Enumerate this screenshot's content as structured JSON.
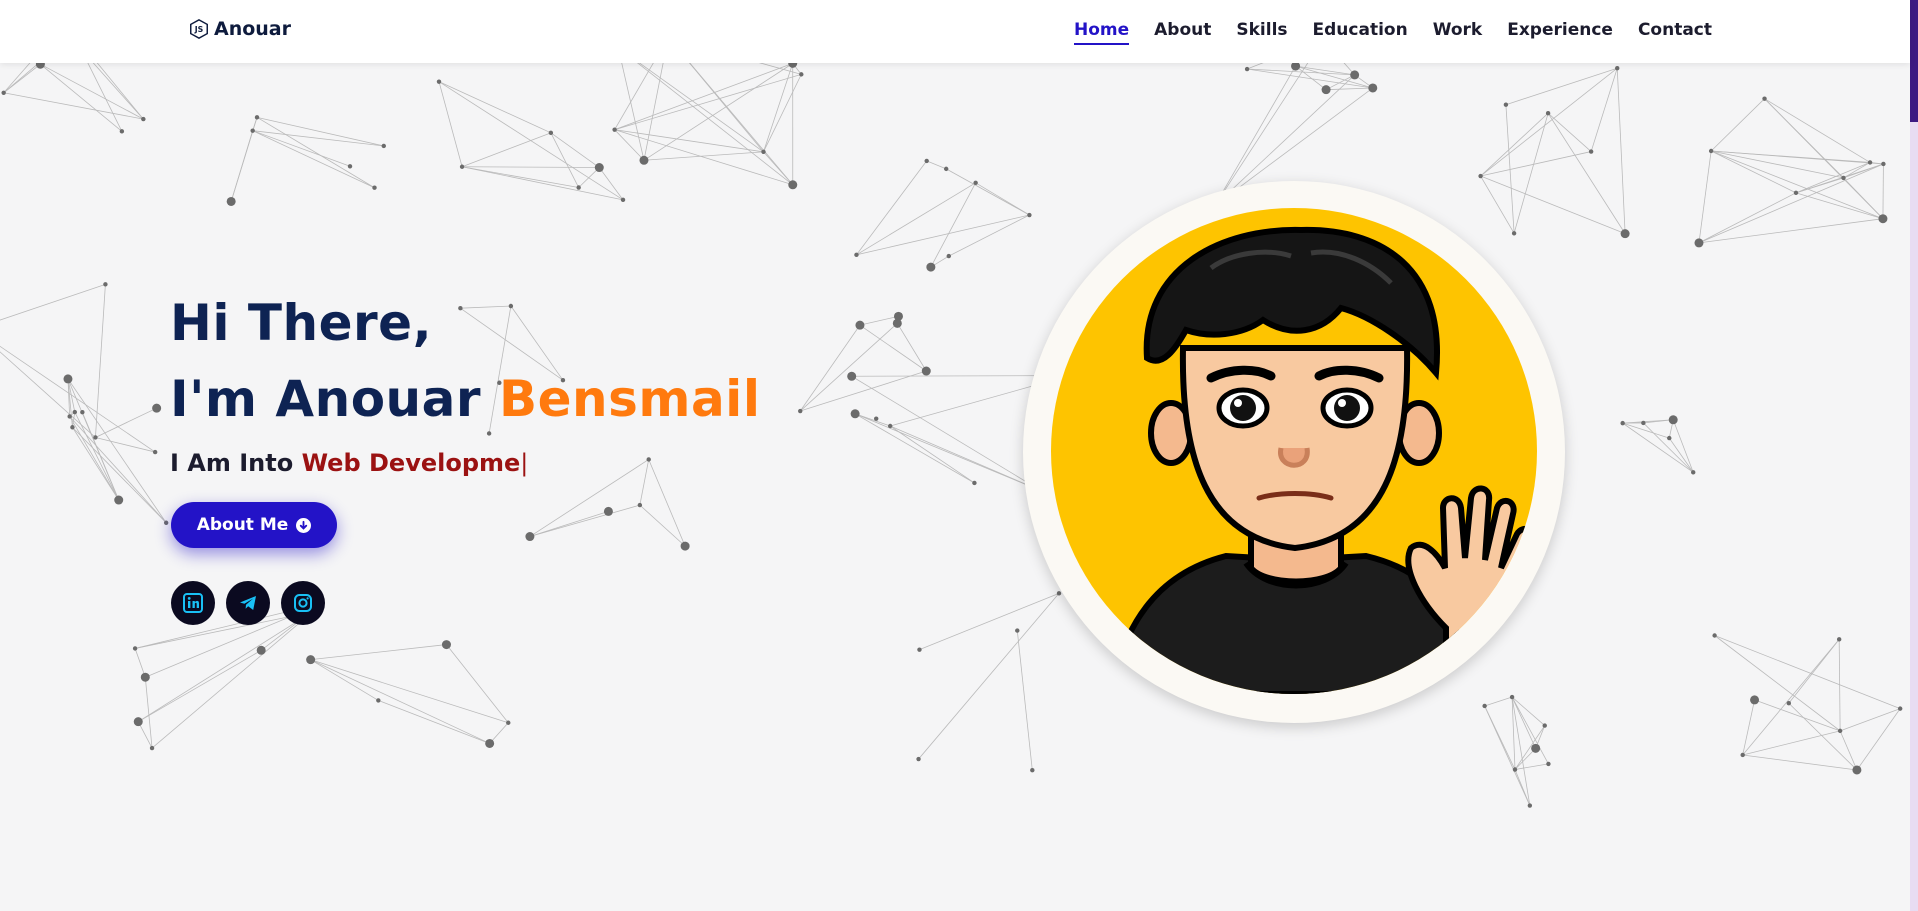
{
  "brand": {
    "name": "Anouar",
    "icon": "nodejs-icon"
  },
  "nav": {
    "items": [
      {
        "label": "Home",
        "active": true
      },
      {
        "label": "About",
        "active": false
      },
      {
        "label": "Skills",
        "active": false
      },
      {
        "label": "Education",
        "active": false
      },
      {
        "label": "Work",
        "active": false
      },
      {
        "label": "Experience",
        "active": false
      },
      {
        "label": "Contact",
        "active": false
      }
    ]
  },
  "hero": {
    "greeting_line1": "Hi There,",
    "greeting_line2_prefix": "I'm Anouar ",
    "greeting_line2_highlight": "Bensmail",
    "typed_prefix": "I Am Into ",
    "typed_text": "Web Developme",
    "cursor": "|",
    "about_button_label": "About Me",
    "about_button_icon": "arrow-down-circle-icon",
    "socials": [
      {
        "name": "linkedin",
        "icon": "linkedin-icon"
      },
      {
        "name": "telegram",
        "icon": "telegram-icon"
      },
      {
        "name": "instagram",
        "icon": "instagram-icon"
      }
    ]
  },
  "colors": {
    "primary": "#2313c7",
    "heading": "#0e2353",
    "highlight": "#ff7a0e",
    "typed": "#9b1212",
    "avatar_bg": "#fec400",
    "social_icon": "#19c0f5"
  }
}
